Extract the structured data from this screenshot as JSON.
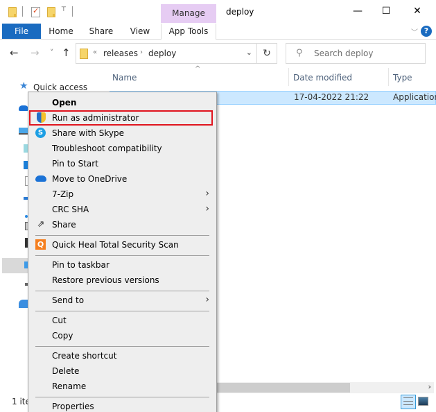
{
  "window": {
    "title": "deploy",
    "contextual_tab_group": "Manage",
    "buttons": {
      "minimize": "—",
      "maximize": "☐",
      "close": "✕"
    }
  },
  "quick_access_toolbar": {
    "icons": [
      "folder-icon",
      "properties-icon",
      "new-folder-icon",
      "customize-dropdown-icon"
    ],
    "dropdown_glyph": "⊤"
  },
  "ribbon": {
    "tabs": [
      {
        "label": "File"
      },
      {
        "label": "Home"
      },
      {
        "label": "Share"
      },
      {
        "label": "View"
      },
      {
        "label": "App Tools"
      }
    ],
    "collapse_glyph": "﹀",
    "help_glyph": "?"
  },
  "navigation": {
    "back_glyph": "←",
    "forward_glyph": "→",
    "recent_glyph": "˅",
    "up_glyph": "↑",
    "address": {
      "overflow": "«",
      "crumbs": [
        "releases",
        "deploy"
      ],
      "separator": "›",
      "dropdown_glyph": "⌄"
    },
    "refresh_glyph": "↻",
    "search": {
      "placeholder": "Search deploy",
      "glyph": "⚲"
    }
  },
  "file_list": {
    "columns": [
      {
        "label": "Name"
      },
      {
        "label": "Date modified"
      },
      {
        "label": "Type"
      }
    ],
    "sort_glyph": "^",
    "rows": [
      {
        "name": "",
        "date_modified": "17-04-2022 21:22",
        "type": "Application",
        "selected": true
      }
    ]
  },
  "nav_pane": {
    "quick_access": "Quick access",
    "star_glyph": "★"
  },
  "context_menu": {
    "highlight_color": "#e0141e",
    "items": [
      {
        "label": "Open",
        "bold": true
      },
      {
        "label": "Run as administrator",
        "icon": "shield-icon",
        "highlighted": true
      },
      {
        "label": "Share with Skype",
        "icon": "skype-icon",
        "icon_glyph": "S"
      },
      {
        "label": "Troubleshoot compatibility"
      },
      {
        "label": "Pin to Start"
      },
      {
        "label": "Move to OneDrive",
        "icon": "onedrive-icon"
      },
      {
        "label": "7-Zip",
        "submenu": true
      },
      {
        "label": "CRC SHA",
        "submenu": true
      },
      {
        "label": "Share",
        "icon": "share-icon",
        "icon_glyph": "⇗"
      },
      {
        "label": "Quick Heal Total Security Scan",
        "icon": "quickheal-icon",
        "icon_glyph": "Q"
      },
      {
        "label": "Pin to taskbar"
      },
      {
        "label": "Restore previous versions"
      },
      {
        "label": "Send to",
        "submenu": true
      },
      {
        "label": "Cut"
      },
      {
        "label": "Copy"
      },
      {
        "label": "Create shortcut"
      },
      {
        "label": "Delete"
      },
      {
        "label": "Rename"
      },
      {
        "label": "Properties"
      }
    ],
    "submenu_glyph": "›"
  },
  "status_bar": {
    "item_count": "1 ite"
  },
  "scrollbar": {
    "right_glyph": "›"
  }
}
